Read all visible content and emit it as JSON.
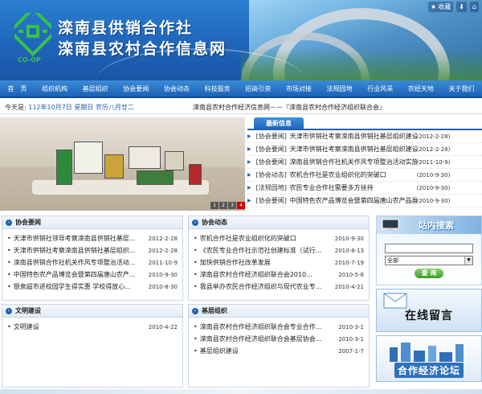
{
  "header": {
    "title_line1": "滦南县供销合作社",
    "title_line2": "滦南县农村合作信息网",
    "logo_text": "CO-OP",
    "favorite_label": "收藏",
    "icon_buttons": [
      "download-icon",
      "home-icon"
    ]
  },
  "nav": {
    "items": [
      "首　页",
      "组织机构",
      "基层组织",
      "协会要闻",
      "协会动态",
      "科技服务",
      "招商引资",
      "市场对接",
      "法规园地",
      "行业风采",
      "农经天地",
      "关于我们"
    ]
  },
  "infobar": {
    "date_prefix": "今天是:",
    "date_value": "112年10月7日 星期日 农历八月廿二",
    "scroll_text": "滦南县农村合作经济信息网－－『滦南县农村合作经济组织联合会』"
  },
  "slideshow": {
    "pages": [
      "1",
      "2",
      "3",
      "4"
    ],
    "active_page": "4"
  },
  "latest": {
    "tab_label": "最新信息",
    "items": [
      {
        "cat": "[协会要闻]",
        "title": "天津市供销社考察滦南县供销社基层组织建设",
        "date": "(2012-2-28)"
      },
      {
        "cat": "[协会要闻]",
        "title": "天津市供销社考察滦南县供销社基层组织建设",
        "date": "(2012-2-28)"
      },
      {
        "cat": "[协会要闻]",
        "title": "滦南县供销合作社机关作风专项整治活动实施方案",
        "date": "(2011-10-9)"
      },
      {
        "cat": "[协会动态]",
        "title": "农机合作社是农业组织化的突破口",
        "date": "(2010-9-30)"
      },
      {
        "cat": "[法规园地]",
        "title": "农民专业合作社需要多方扶持",
        "date": "(2010-9-30)"
      },
      {
        "cat": "[协会要闻]",
        "title": "中国特色农产品博览会暨第四届唐山农产品展示交...",
        "date": "(2010-9-30)"
      }
    ]
  },
  "panels": {
    "news": {
      "title": "协会要闻",
      "items": [
        {
          "title": "天津市供销社领导考察滦南县供销社基层...",
          "date": "2012-2-28"
        },
        {
          "title": "天津市供销社考察滦南县供销社基层组织...",
          "date": "2012-2-28"
        },
        {
          "title": "滦南县供销合作社机关作风专项整治活动...",
          "date": "2011-10-9"
        },
        {
          "title": "中国特色农产品博览会暨第四届唐山农产...",
          "date": "2010-9-30"
        },
        {
          "title": "银泉超市进校园学生得实惠 学校得放心...",
          "date": "2010-8-30"
        }
      ]
    },
    "dynamics": {
      "title": "协会动态",
      "items": [
        {
          "title": "农机合作社是农业组织化的突破口",
          "date": "2010-9-30"
        },
        {
          "title": "《农民专业合作社示范社创建标准（试行...",
          "date": "2010-8-13"
        },
        {
          "title": "加快供销合作社改革发展",
          "date": "2010-7-19"
        },
        {
          "title": "滦南县农村合作经济组织联合会2010...",
          "date": "2010-5-6"
        },
        {
          "title": "我县举办农民合作经济组织与现代农业专...",
          "date": "2010-4-21"
        }
      ]
    },
    "civil": {
      "title": "文明建设",
      "items": [
        {
          "title": "文明建设",
          "date": "2010-4-22"
        }
      ]
    },
    "grassroots": {
      "title": "基层组织",
      "items": [
        {
          "title": "滦南县农村合作经济组织联合会专业合作...",
          "date": "2010-3-1"
        },
        {
          "title": "滦南县农村合作经济组织联合会基层协会...",
          "date": "2010-3-1"
        },
        {
          "title": "基层组织建设",
          "date": "2007-1-7"
        }
      ]
    }
  },
  "sidebar": {
    "search_title": "站内搜索",
    "search_value": "",
    "select_value": "全部",
    "search_button": "查 询",
    "message_label": "在线留言",
    "forum_label": "合作经济论坛"
  },
  "colors": {
    "brand_blue": "#1f63b5",
    "nav_top": "#3a8bd8",
    "banner": "#1e63b8",
    "active_page": "#cc0000"
  }
}
